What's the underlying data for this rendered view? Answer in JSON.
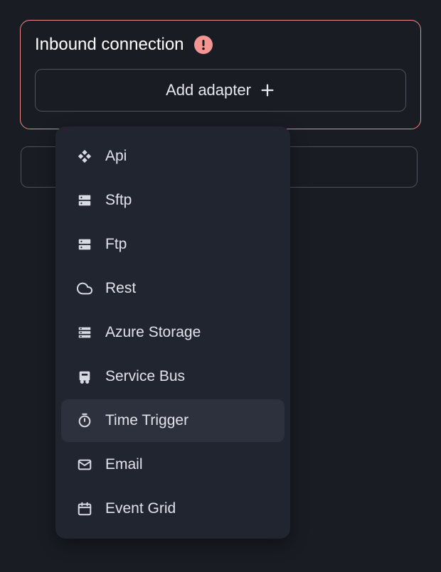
{
  "panel": {
    "title": "Inbound connection",
    "add_adapter_label": "Add adapter"
  },
  "dropdown": {
    "items": [
      {
        "label": "Api"
      },
      {
        "label": "Sftp"
      },
      {
        "label": "Ftp"
      },
      {
        "label": "Rest"
      },
      {
        "label": "Azure Storage"
      },
      {
        "label": "Service Bus"
      },
      {
        "label": "Time Trigger"
      },
      {
        "label": "Email"
      },
      {
        "label": "Event Grid"
      }
    ],
    "highlightedIndex": 6
  }
}
